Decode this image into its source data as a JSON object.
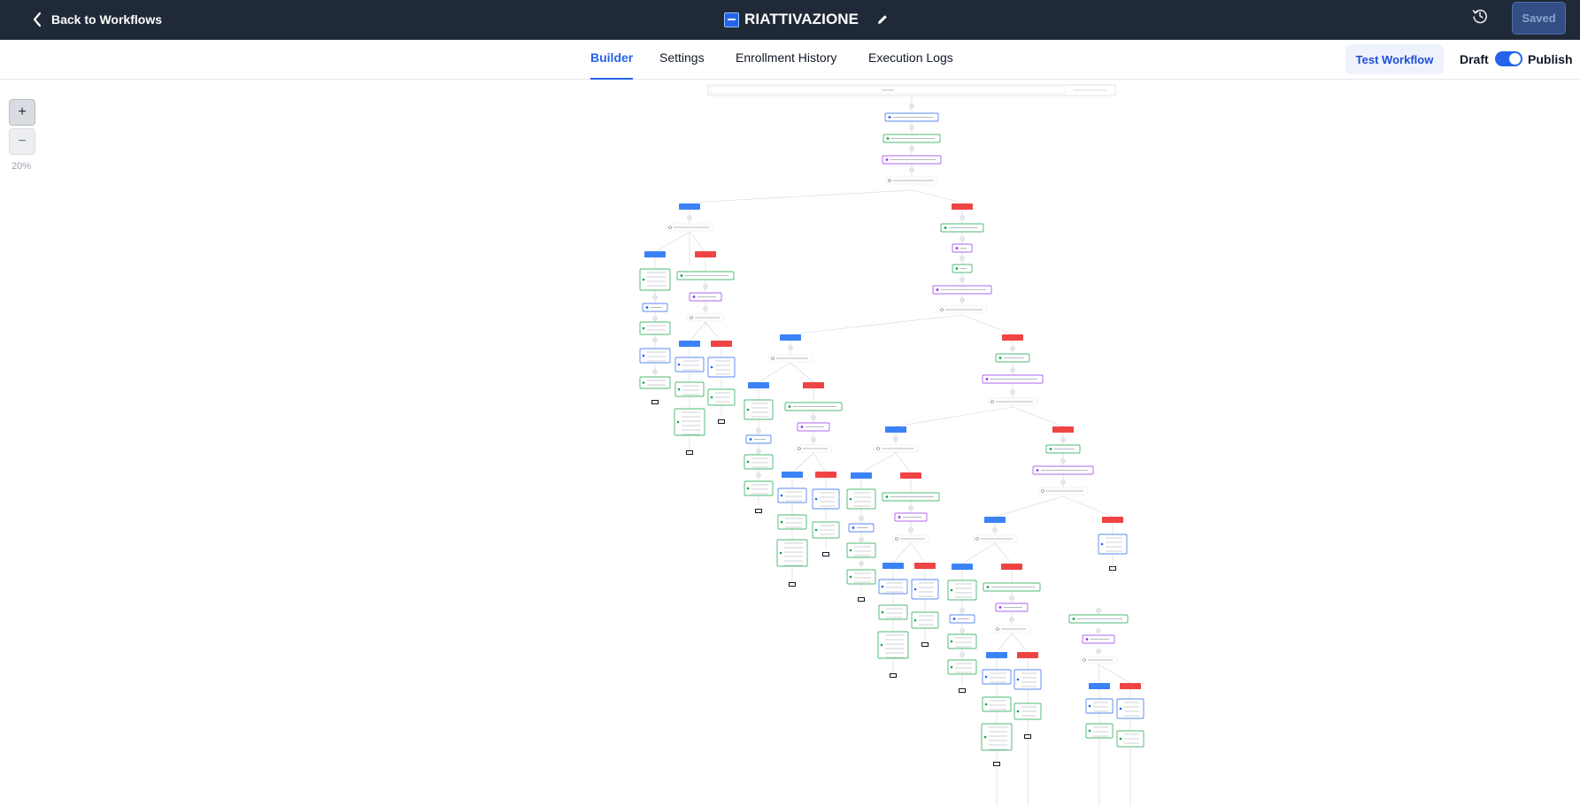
{
  "header": {
    "back_label": "Back to Workflows",
    "workflow_title": "RIATTIVAZIONE",
    "saved_label": "Saved"
  },
  "tabs": [
    {
      "label": "Builder",
      "active": true
    },
    {
      "label": "Settings",
      "active": false
    },
    {
      "label": "Enrollment History",
      "active": false
    },
    {
      "label": "Execution Logs",
      "active": false
    }
  ],
  "actions": {
    "test_label": "Test Workflow",
    "draft_label": "Draft",
    "publish_label": "Publish",
    "publish_enabled": true
  },
  "zoom": {
    "in_symbol": "+",
    "out_symbol": "−",
    "level": "20%"
  },
  "colors": {
    "topbar": "#1f2937",
    "accent": "#2563eb",
    "branch_yes": "#3b82f6",
    "branch_no": "#ef4444",
    "action_green": "#16a34a",
    "action_purple": "#9333ea"
  },
  "icons": {
    "back": "chevron-left-icon",
    "edit": "pencil-icon",
    "history": "history-icon",
    "workflow": "workflow-icon"
  }
}
